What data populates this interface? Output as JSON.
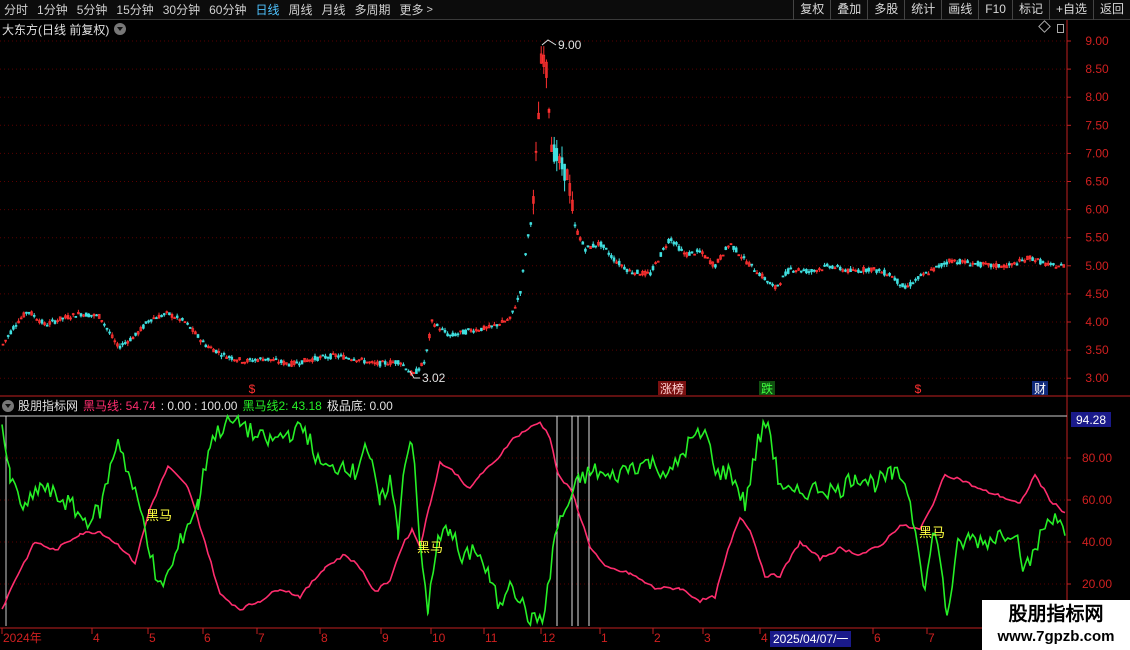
{
  "toolbar": {
    "periods": [
      {
        "label": "分时"
      },
      {
        "label": "1分钟"
      },
      {
        "label": "5分钟"
      },
      {
        "label": "15分钟"
      },
      {
        "label": "30分钟"
      },
      {
        "label": "60分钟"
      },
      {
        "label": "日线"
      },
      {
        "label": "周线"
      },
      {
        "label": "月线"
      },
      {
        "label": "多周期"
      },
      {
        "label": "更多"
      }
    ],
    "active_period": "日线",
    "more_arrow": ">",
    "tools": [
      "复权",
      "叠加",
      "多股",
      "统计",
      "画线",
      "F10",
      "标记",
      "+自选",
      "返回"
    ]
  },
  "main_chart": {
    "title": "大东方(日线 前复权)",
    "price_axis": [
      "9.00",
      "8.50",
      "8.00",
      "7.50",
      "7.00",
      "6.50",
      "6.00",
      "5.50",
      "5.00",
      "4.50",
      "4.00",
      "3.50",
      "3.00"
    ],
    "high_label": "9.00",
    "low_label": "3.02",
    "markers": [
      {
        "text": "$",
        "color": "#ff3030"
      },
      {
        "text": "涨榜",
        "color": "#ffd0d0"
      },
      {
        "text": "跌",
        "color": "#40ff40"
      },
      {
        "text": "$",
        "color": "#ff3030"
      },
      {
        "text": "财",
        "color": "#ffffff"
      }
    ]
  },
  "indicator": {
    "name": "股朋指标网",
    "line1_label": "黑马线: 54.74",
    "range_text": ": 0.00 : 100.00",
    "line2_label": "黑马线2: 43.18",
    "bottom_label": "极品底: 0.00",
    "axis": [
      "94.28",
      "80.00",
      "60.00",
      "40.00",
      "20.00"
    ],
    "signal_text": "黑马",
    "colors": {
      "line1": "#ff2d6e",
      "line2": "#26f026",
      "signal": "#ffff40"
    }
  },
  "time_axis": [
    "2024年",
    "4",
    "5",
    "6",
    "7",
    "8",
    "9",
    "10",
    "11",
    "12",
    "1",
    "2",
    "3",
    "4",
    "6",
    "7"
  ],
  "date_box": "2025/04/07/一",
  "watermark": {
    "title": "股朋指标网",
    "url": "www.7gpzb.com"
  },
  "chart_data": [
    {
      "type": "candlestick",
      "title": "大东方(日线 前复权)",
      "ylim": [
        2.9,
        9.2
      ],
      "annotations": [
        {
          "label": "9.00",
          "value": 9.0,
          "x": "2024-12"
        },
        {
          "label": "3.02",
          "value": 3.02,
          "x": "2024-09"
        }
      ],
      "x": [
        "2024-03",
        "2024-04",
        "2024-05",
        "2024-06",
        "2024-07",
        "2024-08",
        "2024-09",
        "2024-10",
        "2024-11",
        "2024-12",
        "2025-01",
        "2025-02",
        "2025-03",
        "2025-04",
        "2025-05",
        "2025-06",
        "2025-07"
      ],
      "close": [
        4.05,
        4.1,
        3.5,
        3.3,
        3.25,
        3.3,
        3.3,
        3.95,
        4.1,
        8.0,
        5.4,
        5.2,
        5.1,
        4.9,
        5.0,
        4.9,
        5.05
      ]
    },
    {
      "type": "line",
      "series": [
        {
          "name": "黑马线",
          "values": [
            15,
            38,
            45,
            70,
            22,
            8,
            18,
            45,
            78,
            92,
            35,
            20,
            12,
            48,
            35,
            40,
            63,
            56
          ]
        },
        {
          "name": "黑马线2",
          "values": [
            82,
            55,
            60,
            18,
            88,
            85,
            75,
            5,
            50,
            3,
            70,
            80,
            82,
            58,
            62,
            40,
            45,
            43
          ]
        }
      ],
      "ylim": [
        0,
        100
      ]
    }
  ]
}
